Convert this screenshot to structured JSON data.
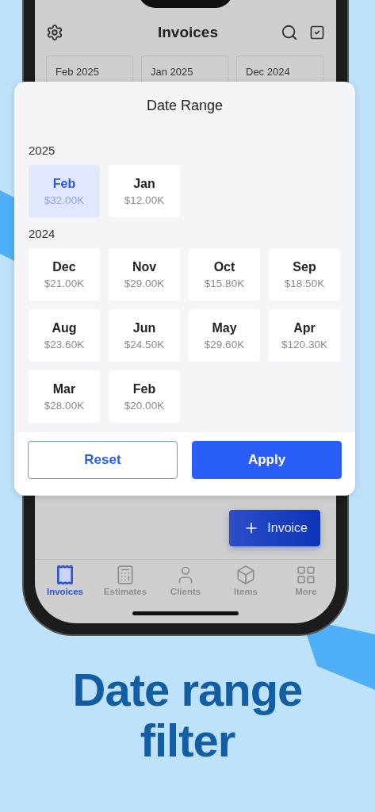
{
  "header": {
    "title": "Invoices"
  },
  "month_chips": [
    "Feb 2025",
    "Jan 2025",
    "Dec 2024"
  ],
  "date_range": {
    "title": "Date Range",
    "years": [
      {
        "year": "2025",
        "months": [
          {
            "name": "Feb",
            "amount": "$32.00K",
            "selected": true
          },
          {
            "name": "Jan",
            "amount": "$12.00K",
            "selected": false
          }
        ]
      },
      {
        "year": "2024",
        "months": [
          {
            "name": "Dec",
            "amount": "$21.00K",
            "selected": false
          },
          {
            "name": "Nov",
            "amount": "$29.00K",
            "selected": false
          },
          {
            "name": "Oct",
            "amount": "$15.80K",
            "selected": false
          },
          {
            "name": "Sep",
            "amount": "$18.50K",
            "selected": false
          },
          {
            "name": "Aug",
            "amount": "$23.60K",
            "selected": false
          },
          {
            "name": "Jun",
            "amount": "$24.50K",
            "selected": false
          },
          {
            "name": "May",
            "amount": "$29.60K",
            "selected": false
          },
          {
            "name": "Apr",
            "amount": "$120.30K",
            "selected": false
          },
          {
            "name": "Mar",
            "amount": "$28.00K",
            "selected": false
          },
          {
            "name": "Feb",
            "amount": "$20.00K",
            "selected": false
          }
        ]
      }
    ],
    "reset": "Reset",
    "apply": "Apply"
  },
  "fab": {
    "label": "Invoice"
  },
  "tabs": [
    {
      "label": "Invoices",
      "selected": true
    },
    {
      "label": "Estimates",
      "selected": false
    },
    {
      "label": "Clients",
      "selected": false
    },
    {
      "label": "Items",
      "selected": false
    },
    {
      "label": "More",
      "selected": false
    }
  ],
  "headline": "Date range filter"
}
